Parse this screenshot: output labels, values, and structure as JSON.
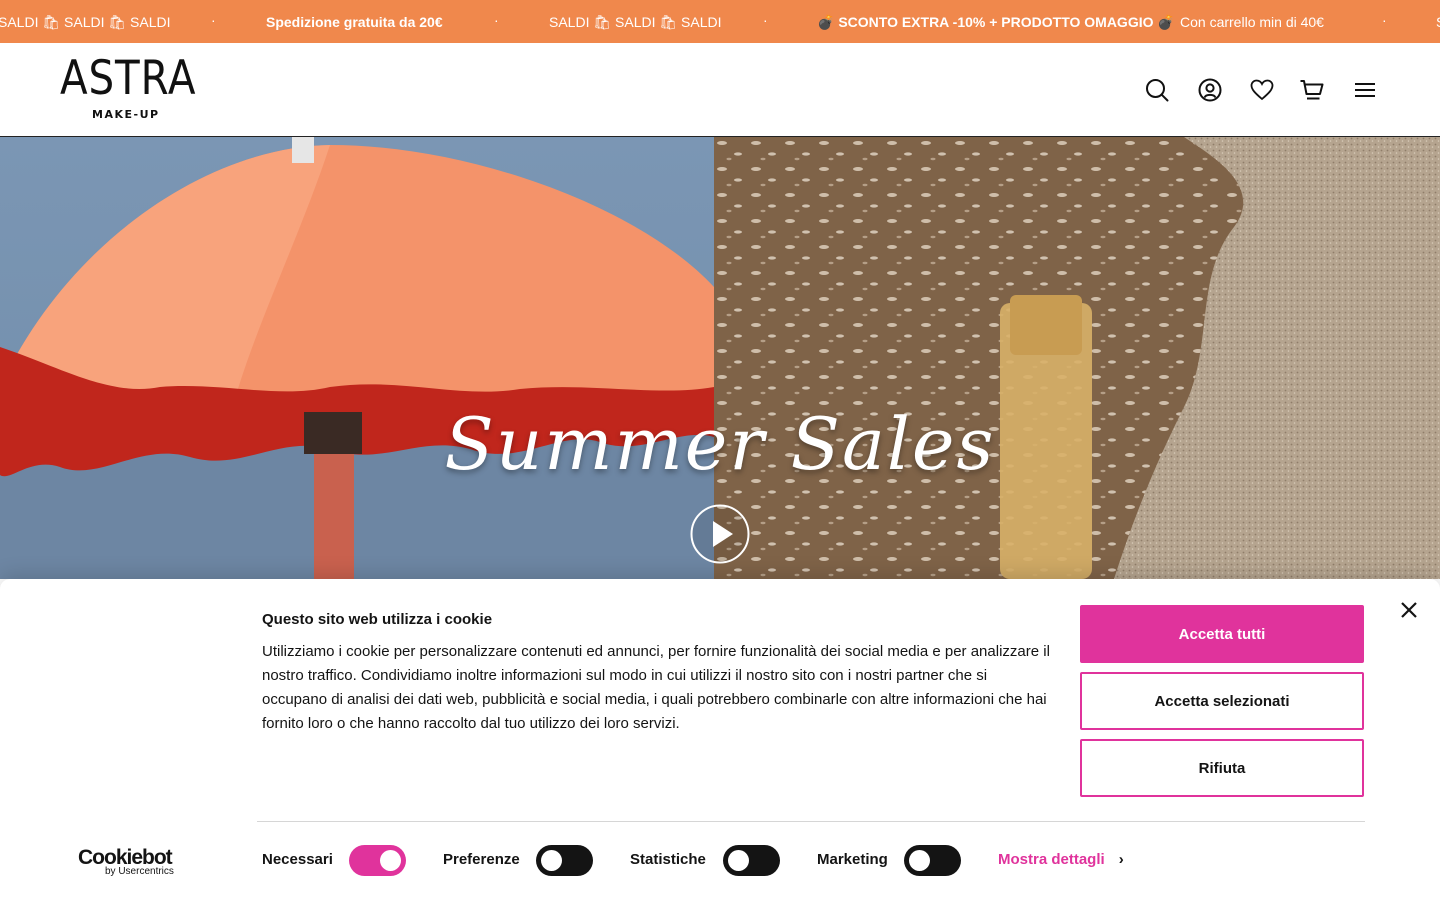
{
  "announcement": {
    "items": [
      {
        "text": "SALDI 🛍 SALDI 🛍 SALDI",
        "bold": false
      },
      {
        "text": "·",
        "bold": false
      },
      {
        "text": "Spedizione gratuita da 20€",
        "bold": true
      },
      {
        "text": "·",
        "bold": false
      },
      {
        "text": "SALDI 🛍 SALDI 🛍 SALDI",
        "bold": false
      },
      {
        "text": "·",
        "bold": false
      },
      {
        "text": "💣 SCONTO EXTRA -10% + PRODOTTO OMAGGIO 💣",
        "bold": true
      },
      {
        "text": "Con carrello min di 40€",
        "bold": false
      },
      {
        "text": "·",
        "bold": false
      },
      {
        "text": "S",
        "bold": false
      }
    ],
    "background": "#f0884c"
  },
  "header": {
    "logo_main": "ASTRA",
    "logo_sub": "MAKE-UP",
    "icons": [
      "search-icon",
      "account-icon",
      "wishlist-icon",
      "cart-icon",
      "menu-icon"
    ]
  },
  "hero": {
    "headline": "Summer Sales",
    "play_icon": "play-icon"
  },
  "cookie": {
    "title": "Questo sito web utilizza i cookie",
    "body": "Utilizziamo i cookie per personalizzare contenuti ed annunci, per fornire funzionalità dei social media e per analizzare il nostro traffico. Condividiamo inoltre informazioni sul modo in cui utilizzi il nostro sito con i nostri partner che si occupano di analisi dei dati web, pubblicità e social media, i quali potrebbero combinarle con altre informazioni che hai fornito loro o che hanno raccolto dal tuo utilizzo dei loro servizi.",
    "accept_all": "Accetta tutti",
    "accept_selected": "Accetta selezionati",
    "reject": "Rifiuta",
    "brand_name": "Cookiebot",
    "brand_by": "by Usercentrics",
    "toggles": [
      {
        "label": "Necessari",
        "on": true
      },
      {
        "label": "Preferenze",
        "on": false
      },
      {
        "label": "Statistiche",
        "on": false
      },
      {
        "label": "Marketing",
        "on": false
      }
    ],
    "details_link": "Mostra dettagli",
    "accent": "#e0339c"
  }
}
